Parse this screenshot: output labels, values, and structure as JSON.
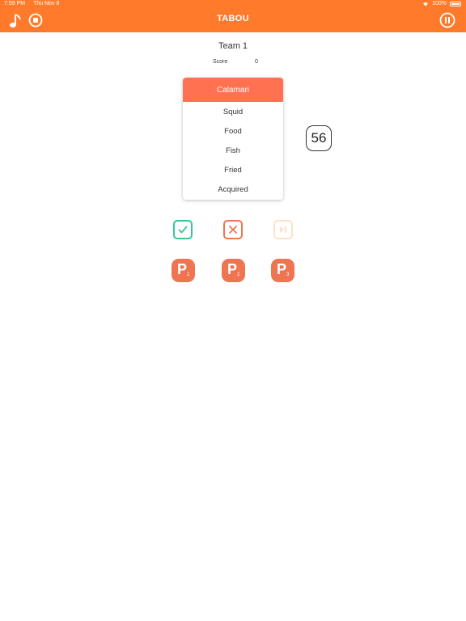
{
  "status_bar": {
    "time": "7:59 PM",
    "date": "Thu Nov 8",
    "battery": "100%"
  },
  "header": {
    "title": "TABOU",
    "icons": [
      "music-note-icon",
      "stop-icon",
      "pause-icon"
    ]
  },
  "team": {
    "name": "Team 1",
    "score_label": "Score",
    "score_value": "0"
  },
  "card": {
    "word": "Calamari",
    "taboo_words": [
      "Squid",
      "Food",
      "Fish",
      "Fried",
      "Acquired"
    ]
  },
  "timer": {
    "value": "56"
  },
  "actions": {
    "icons": [
      "check-icon",
      "cross-icon",
      "skip-icon"
    ]
  },
  "passes": [
    {
      "letter": "P",
      "number": "1"
    },
    {
      "letter": "P",
      "number": "2"
    },
    {
      "letter": "P",
      "number": "3"
    }
  ],
  "colors": {
    "header": "#ff7a2a",
    "card_head": "#ff7151",
    "correct": "#35c79a",
    "wrong": "#ef7552",
    "skip": "#fde2c6",
    "pass": "#ef7552"
  }
}
